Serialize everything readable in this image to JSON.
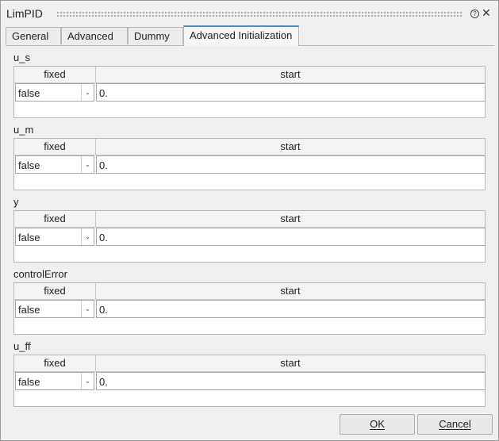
{
  "window": {
    "title": "LimPID",
    "help_icon": "help-circle-icon",
    "close_icon": "close-icon",
    "close_glyph": "✕",
    "help_glyph": "?"
  },
  "tabs": [
    {
      "label": "General",
      "active": false
    },
    {
      "label": "Advanced",
      "active": false
    },
    {
      "label": "Dummy",
      "active": false
    },
    {
      "label": "Advanced Initialization",
      "active": true
    }
  ],
  "sections": [
    {
      "label": "u_s",
      "fixed_header": "fixed",
      "start_header": "start",
      "fixed_value": "false",
      "start_value": "0."
    },
    {
      "label": "u_m",
      "fixed_header": "fixed",
      "start_header": "start",
      "fixed_value": "false",
      "start_value": "0."
    },
    {
      "label": "y",
      "fixed_header": "fixed",
      "start_header": "start",
      "fixed_value": "false",
      "start_value": "0."
    },
    {
      "label": "controlError",
      "fixed_header": "fixed",
      "start_header": "start",
      "fixed_value": "false",
      "start_value": "0."
    },
    {
      "label": "u_ff",
      "fixed_header": "fixed",
      "start_header": "start",
      "fixed_value": "false",
      "start_value": "0."
    }
  ],
  "dropdown_glyph": "⌄",
  "buttons": {
    "ok": "OK",
    "cancel": "Cancel"
  },
  "colors": {
    "active_tab_accent": "#4a90c8",
    "background": "#f0f0f0"
  }
}
